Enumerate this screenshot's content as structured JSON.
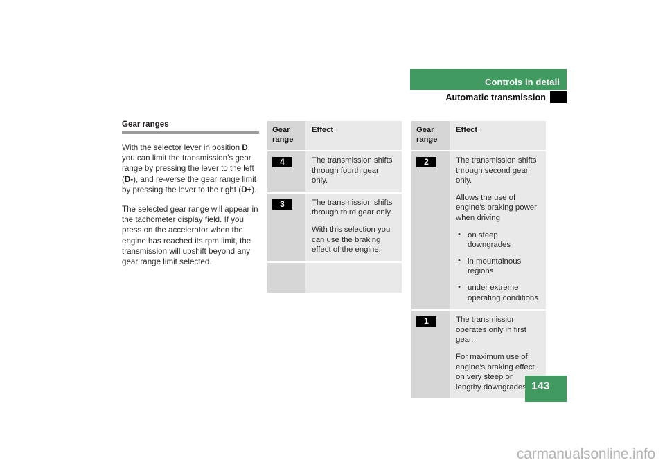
{
  "header": {
    "chapter_title": "Controls in detail",
    "section_title": "Automatic transmission",
    "bar_color": "#419a5f",
    "tab_color": "#000000"
  },
  "left_column": {
    "section_title": "Gear ranges",
    "paragraphs": [
      {
        "parts": [
          {
            "text": "With the selector lever in position ",
            "bold": false
          },
          {
            "text": "D",
            "bold": true
          },
          {
            "text": ", you can limit the transmission’s gear range by pressing the lever to the left (",
            "bold": false
          },
          {
            "text": "D-",
            "bold": true
          },
          {
            "text": "), and re-verse the gear range limit by pressing the lever to the right (",
            "bold": false
          },
          {
            "text": "D+",
            "bold": true
          },
          {
            "text": ").",
            "bold": false
          }
        ]
      },
      {
        "parts": [
          {
            "text": "The selected gear range will appear in the tachometer display field. If you press on the accelerator when the engine has reached its rpm limit, the transmission will upshift beyond any gear range limit selected.",
            "bold": false
          }
        ]
      }
    ]
  },
  "table_1": {
    "headers": {
      "gear_range": "Gear range",
      "effect": "Effect"
    },
    "rows": [
      {
        "gear": "4",
        "paragraphs": [
          "The transmission shifts through fourth gear only."
        ],
        "bullets": []
      },
      {
        "gear": "3",
        "paragraphs": [
          "The transmission shifts through third gear only.",
          "With this selection you can use the braking effect of the engine."
        ],
        "bullets": []
      }
    ]
  },
  "table_2": {
    "headers": {
      "gear_range": "Gear range",
      "effect": "Effect"
    },
    "rows": [
      {
        "gear": "2",
        "paragraphs": [
          "The transmission shifts through second gear only.",
          "Allows the use of engine’s braking power when driving"
        ],
        "bullets": [
          "on steep downgrades",
          "in mountainous regions",
          "under extreme operating conditions"
        ]
      },
      {
        "gear": "1",
        "paragraphs": [
          "The transmission operates only in first gear.",
          "For maximum use of engine’s braking effect on very steep or lengthy downgrades."
        ],
        "bullets": []
      }
    ]
  },
  "footer": {
    "page_number": "143",
    "watermark": "carmanualsonline.info"
  }
}
